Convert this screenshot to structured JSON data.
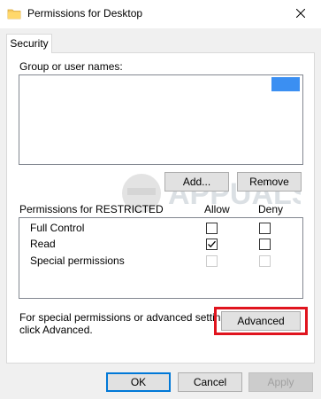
{
  "window": {
    "title": "Permissions for Desktop",
    "close_icon": "close-icon",
    "folder_icon": "folder-icon"
  },
  "tabs": [
    {
      "label": "Security",
      "selected": true
    }
  ],
  "group_section": {
    "label": "Group or user names:"
  },
  "buttons": {
    "add": "Add...",
    "remove": "Remove",
    "advanced": "Advanced",
    "ok": "OK",
    "cancel": "Cancel",
    "apply": "Apply"
  },
  "permissions": {
    "header": "Permissions for RESTRICTED",
    "allow_label": "Allow",
    "deny_label": "Deny",
    "rows": [
      {
        "name": "Full Control",
        "allow": false,
        "deny": false,
        "enabled": true
      },
      {
        "name": "Read",
        "allow": true,
        "deny": false,
        "enabled": true
      },
      {
        "name": "Special permissions",
        "allow": false,
        "deny": false,
        "enabled": false
      }
    ]
  },
  "advanced_hint": {
    "line1": "For special permissions or advanced settings,",
    "line2": "click Advanced."
  },
  "watermark": {
    "text": "APPUALS"
  },
  "colors": {
    "selection": "#3b8ff2",
    "highlight": "#e0141e",
    "default_button_border": "#0078d7"
  }
}
